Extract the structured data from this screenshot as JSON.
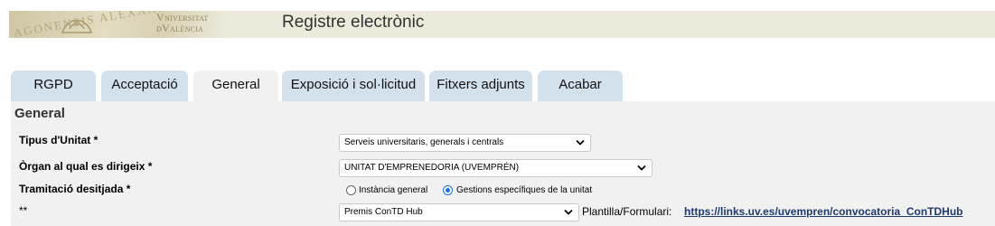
{
  "header": {
    "logo_seal_text": "AGONENSIS ALEXAND",
    "logo_name_line1": "Vniversitat",
    "logo_name_line2": "dValència",
    "title": "Registre electrònic"
  },
  "tabs": [
    {
      "label": "RGPD",
      "active": false
    },
    {
      "label": "Acceptació",
      "active": false
    },
    {
      "label": "General",
      "active": true
    },
    {
      "label": "Exposició i sol·licitud",
      "active": false
    },
    {
      "label": "Fitxers adjunts",
      "active": false
    },
    {
      "label": "Acabar",
      "active": false
    }
  ],
  "section": {
    "title": "General"
  },
  "form": {
    "tipus_unitat": {
      "label": "Tipus d'Unitat *",
      "value": "Serveis universitaris, generals i centrals"
    },
    "organ": {
      "label": "Òrgan al qual es dirigeix *",
      "value": "UNITAT D'EMPRENEDORIA (UVEMPRÉN)"
    },
    "tramitacio": {
      "label": "Tramitació desitjada *",
      "options": [
        {
          "label": "Instància general",
          "checked": false
        },
        {
          "label": "Gestions específiques de la unitat",
          "checked": true
        }
      ]
    },
    "gestio": {
      "label": "**",
      "value": "Premis ConTD Hub"
    },
    "plantilla": {
      "label": "Plantilla/Formulari:",
      "link": "https://links.uv.es/uvempren/convocatoria_ConTDHub"
    }
  },
  "colors": {
    "header_bg": "#eceadb",
    "tab_bg": "#d3e1ec",
    "panel_bg": "#f1f1f1",
    "link": "#1e3a6e",
    "radio_accent": "#1a73e8"
  }
}
